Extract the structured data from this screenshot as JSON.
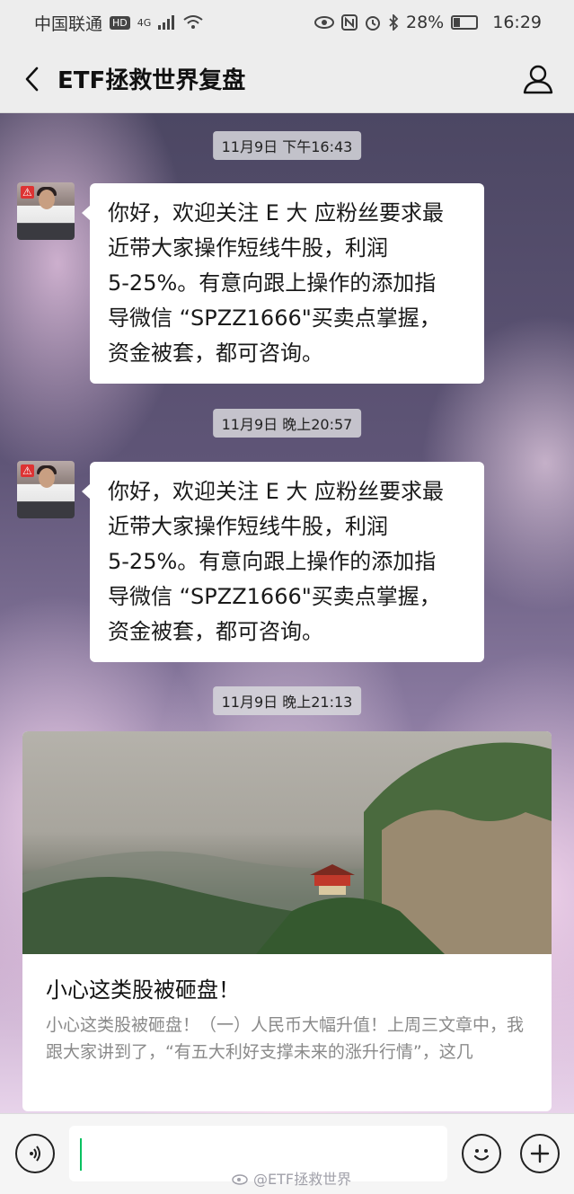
{
  "status_bar": {
    "carrier": "中国联通",
    "hd_badge": "HD",
    "network": "4G",
    "battery": "28%",
    "time": "16:29"
  },
  "header": {
    "title": "ETF拯救世界复盘"
  },
  "messages": [
    {
      "timestamp": "11月9日 下午16:43",
      "lines": [
        "你好，欢迎关注 E 大 应粉丝要求最",
        "近带大家操作短线牛股，利润",
        "5-25%。有意向跟上操作的添加指",
        "导微信 “SPZZ1666\"买卖点掌握，",
        "资金被套，都可咨询。"
      ]
    },
    {
      "timestamp": "11月9日 晚上20:57",
      "lines": [
        "你好，欢迎关注 E 大 应粉丝要求最",
        "近带大家操作短线牛股，利润",
        "5-25%。有意向跟上操作的添加指",
        "导微信 “SPZZ1666\"买卖点掌握，",
        "资金被套，都可咨询。"
      ]
    }
  ],
  "article": {
    "timestamp": "11月9日 晚上21:13",
    "title": "小心这类股被砸盘！",
    "description": "小心这类股被砸盘！（一）人民币大幅升值！上周三文章中，我跟大家讲到了，“有五大利好支撑未来的涨升行情”，这几"
  },
  "watermark": "@ETF拯救世界",
  "icons": {
    "back": "chevron-left-icon",
    "profile": "person-icon",
    "voice": "voice-icon",
    "emoji": "emoji-icon",
    "plus": "plus-icon"
  }
}
